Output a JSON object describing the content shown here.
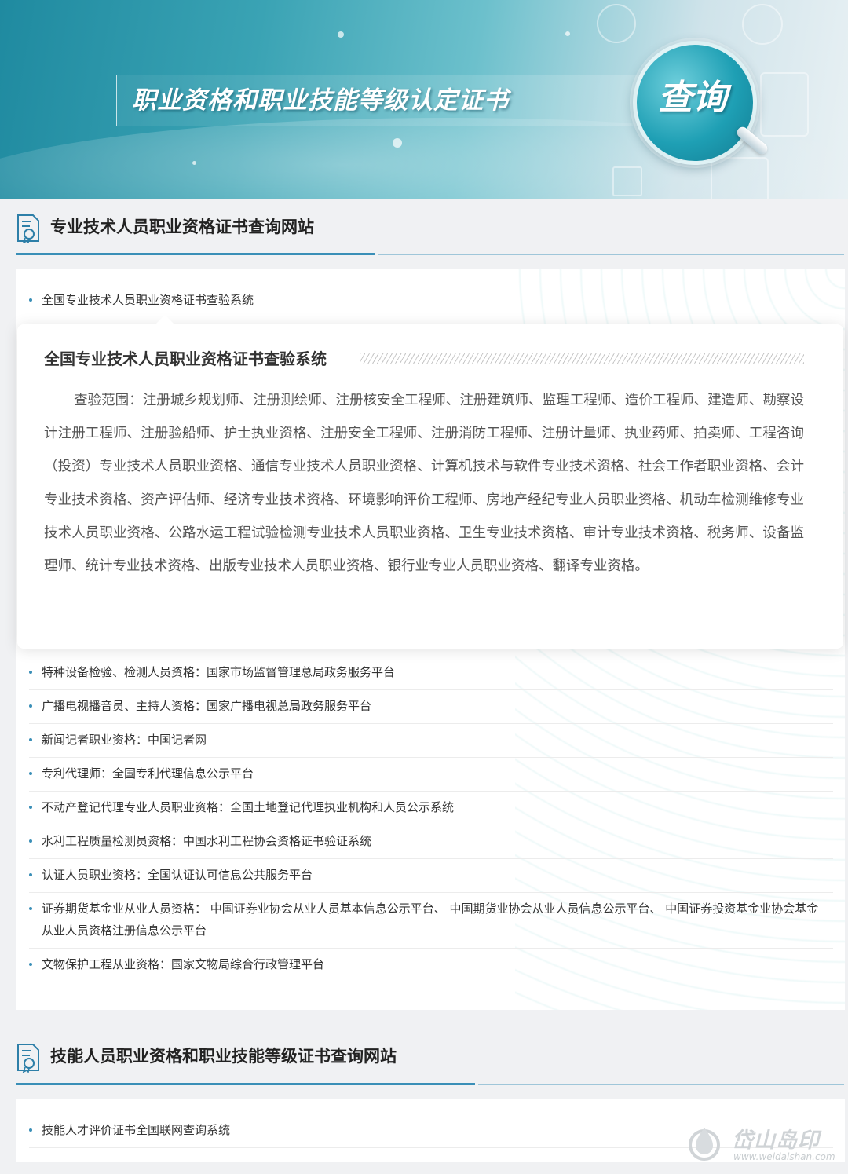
{
  "banner": {
    "title": "职业资格和职业技能等级认定证书",
    "lens_text": "查询"
  },
  "section1": {
    "title": "专业技术人员职业资格证书查询网站",
    "first_item": "全国专业技术人员职业资格证书查验系统",
    "popup": {
      "title": "全国专业技术人员职业资格证书查验系统",
      "body": "查验范围：注册城乡规划师、注册测绘师、注册核安全工程师、注册建筑师、监理工程师、造价工程师、建造师、勘察设计注册工程师、注册验船师、护士执业资格、注册安全工程师、注册消防工程师、注册计量师、执业药师、拍卖师、工程咨询（投资）专业技术人员职业资格、通信专业技术人员职业资格、计算机技术与软件专业技术资格、社会工作者职业资格、会计专业技术资格、资产评估师、经济专业技术资格、环境影响评价工程师、房地产经纪专业人员职业资格、机动车检测维修专业技术人员职业资格、公路水运工程试验检测专业技术人员职业资格、卫生专业技术资格、审计专业技术资格、税务师、设备监理师、统计专业技术资格、出版专业技术人员职业资格、银行业专业人员职业资格、翻译专业资格。"
    },
    "items": [
      "特种设备检验、检测人员资格：国家市场监督管理总局政务服务平台",
      "广播电视播音员、主持人资格：国家广播电视总局政务服务平台",
      "新闻记者职业资格：中国记者网",
      "专利代理师：全国专利代理信息公示平台",
      "不动产登记代理专业人员职业资格：全国土地登记代理执业机构和人员公示系统",
      "水利工程质量检测员资格：中国水利工程协会资格证书验证系统",
      "认证人员职业资格：全国认证认可信息公共服务平台",
      "证券期货基金业从业人员资格： 中国证券业协会从业人员基本信息公示平台、 中国期货业协会从业人员信息公示平台、 中国证券投资基金业协会基金从业人员资格注册信息公示平台",
      "文物保护工程从业资格：国家文物局综合行政管理平台"
    ]
  },
  "section2": {
    "title": "技能人员职业资格和职业技能等级证书查询网站",
    "items": [
      "技能人才评价证书全国联网查询系统"
    ]
  },
  "watermark_logo": {
    "name": "岱山岛印",
    "url": "www.weidaishan.com"
  },
  "colors": {
    "accent": "#3a8fb7",
    "banner_teal": "#1f8aa0",
    "background": "#f0f1f3"
  }
}
